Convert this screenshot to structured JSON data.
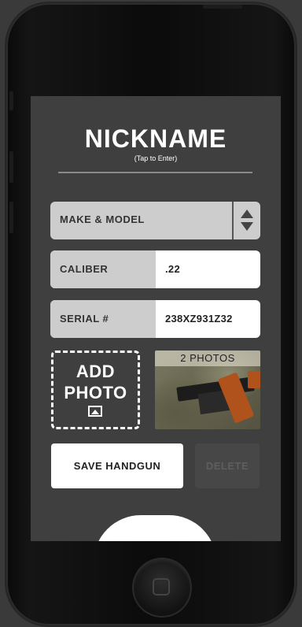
{
  "form": {
    "nickname": "NICKNAME",
    "nickname_hint": "(Tap to Enter)",
    "make_model": {
      "label": "MAKE & MODEL"
    },
    "caliber": {
      "label": "CALIBER",
      "value": ".22"
    },
    "serial": {
      "label": "SERIAL #",
      "value": "238XZ931Z32"
    }
  },
  "photos": {
    "add_label_line1": "ADD",
    "add_label_line2": "PHOTO",
    "count_label": "2 PHOTOS",
    "icon": "image-icon"
  },
  "actions": {
    "save_label": "SAVE HANDGUN",
    "delete_label": "DELETE"
  },
  "colors": {
    "background": "#3f3f3f",
    "field_label_bg": "#cdcdcd",
    "field_value_bg": "#ffffff",
    "delete_disabled": "#474747"
  }
}
